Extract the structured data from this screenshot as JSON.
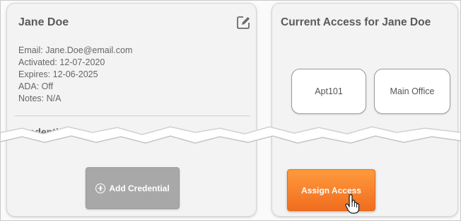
{
  "user_card": {
    "name": "Jane Doe",
    "edit_icon": "edit-pencil-icon",
    "fields": [
      "Email: Jane.Doe@email.com",
      "Activated: 12-07-2020",
      "Expires: 12-06-2025",
      "ADA: Off",
      "Notes: N/A"
    ],
    "credentials_heading": "Credentials",
    "add_credential_label": "Add Credential"
  },
  "access_card": {
    "title": "Current Access for Jane Doe",
    "access_items": [
      "Apt101",
      "Main Office"
    ],
    "assign_button_label": "Assign Access"
  },
  "colors": {
    "accent_orange": "#f58a2c",
    "button_gray": "#a8a8a8",
    "card_bg": "#f3f3f3"
  }
}
